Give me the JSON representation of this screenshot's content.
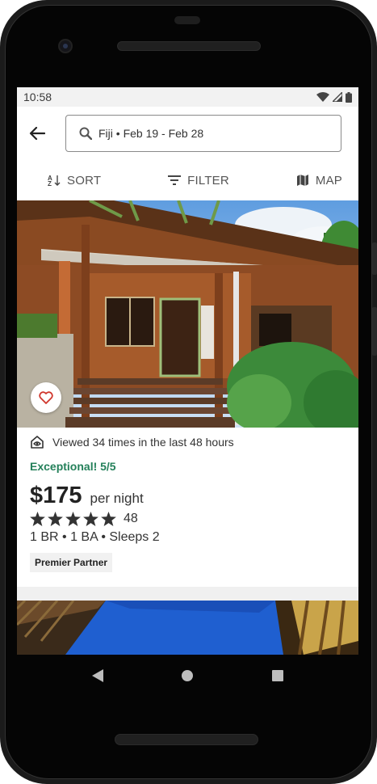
{
  "status_bar": {
    "time": "10:58"
  },
  "search": {
    "back_icon": "arrow-left-icon",
    "search_icon": "magnifier-icon",
    "query": "Fiji • Feb 19 - Feb 28"
  },
  "actions": {
    "sort_label": "SORT",
    "filter_label": "FILTER",
    "map_label": "MAP"
  },
  "listing": {
    "viewed_text": "Viewed 34 times in the last 48 hours",
    "rating_text": "Exceptional! 5/5",
    "price": "$175",
    "price_unit": "per night",
    "stars": 5,
    "review_count": "48",
    "details": "1 BR • 1 BA • Sleeps 2",
    "badge": "Premier Partner",
    "favorite": false
  },
  "colors": {
    "accent_green": "#24805a",
    "heart_red": "#d0362c",
    "text_dark": "#222222"
  }
}
